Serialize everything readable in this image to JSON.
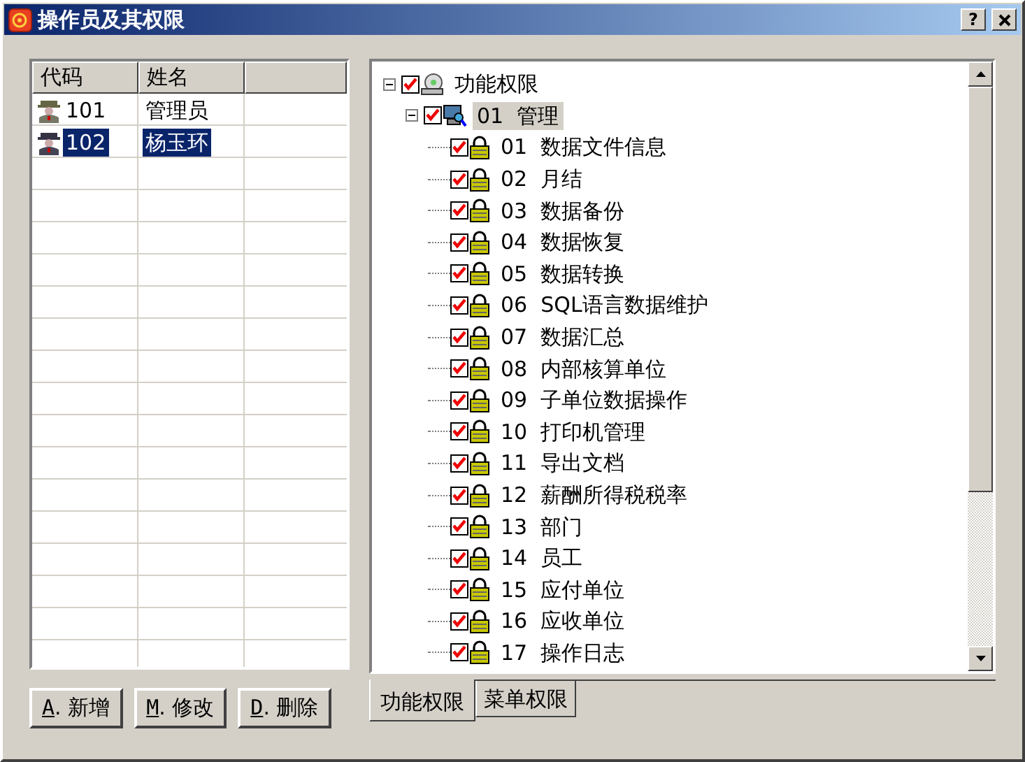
{
  "window": {
    "title": "操作员及其权限",
    "buttons": [
      "?"
    ]
  },
  "operators": {
    "columns": [
      "代码",
      "姓名"
    ],
    "rows": [
      {
        "code": "101",
        "name": "管理员",
        "selected": false
      },
      {
        "code": "102",
        "name": "杨玉环",
        "selected": true
      }
    ]
  },
  "buttons": [
    {
      "accel": "A",
      "rest": ". 新增"
    },
    {
      "accel": "M",
      "rest": ". 修改"
    },
    {
      "accel": "D",
      "rest": ". 删除"
    }
  ],
  "tree": {
    "label": "功能权限",
    "checked": true,
    "expanded": true,
    "kind": "root",
    "children": [
      {
        "label": "01  管理",
        "checked": true,
        "expanded": true,
        "kind": "group",
        "selected": true,
        "children": [
          {
            "label": "01  数据文件信息",
            "checked": true,
            "kind": "leaf"
          },
          {
            "label": "02  月结",
            "checked": true,
            "kind": "leaf"
          },
          {
            "label": "03  数据备份",
            "checked": true,
            "kind": "leaf"
          },
          {
            "label": "04  数据恢复",
            "checked": true,
            "kind": "leaf"
          },
          {
            "label": "05  数据转换",
            "checked": true,
            "kind": "leaf"
          },
          {
            "label": "06  SQL语言数据维护",
            "checked": true,
            "kind": "leaf"
          },
          {
            "label": "07  数据汇总",
            "checked": true,
            "kind": "leaf"
          },
          {
            "label": "08  内部核算单位",
            "checked": true,
            "kind": "leaf"
          },
          {
            "label": "09  子单位数据操作",
            "checked": true,
            "kind": "leaf"
          },
          {
            "label": "10  打印机管理",
            "checked": true,
            "kind": "leaf"
          },
          {
            "label": "11  导出文档",
            "checked": true,
            "kind": "leaf"
          },
          {
            "label": "12  薪酬所得税税率",
            "checked": true,
            "kind": "leaf"
          },
          {
            "label": "13  部门",
            "checked": true,
            "kind": "leaf"
          },
          {
            "label": "14  员工",
            "checked": true,
            "kind": "leaf"
          },
          {
            "label": "15  应付单位",
            "checked": true,
            "kind": "leaf"
          },
          {
            "label": "16  应收单位",
            "checked": true,
            "kind": "leaf"
          },
          {
            "label": "17  操作日志",
            "checked": true,
            "kind": "leaf"
          }
        ]
      }
    ]
  },
  "tabs": [
    {
      "label": "功能权限",
      "selected": true
    },
    {
      "label": "菜单权限",
      "selected": false
    }
  ]
}
